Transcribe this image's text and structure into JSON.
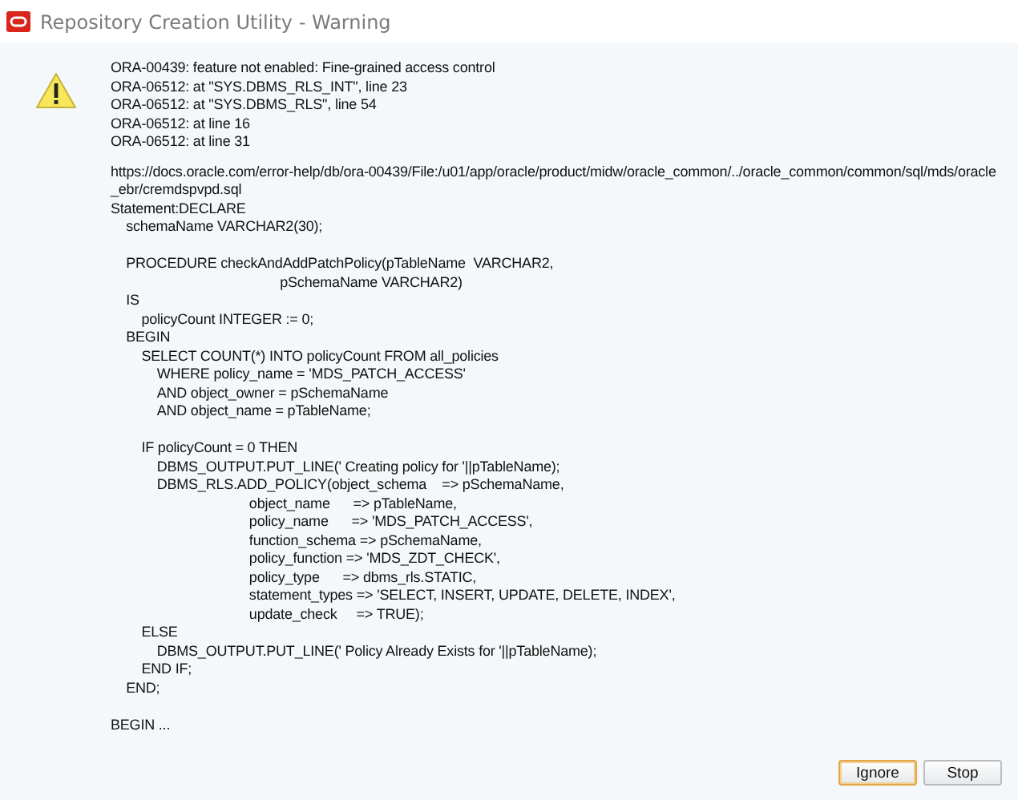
{
  "window": {
    "title": "Repository Creation Utility - Warning"
  },
  "message": {
    "errors": [
      "ORA-00439: feature not enabled: Fine-grained access control",
      "ORA-06512: at \"SYS.DBMS_RLS_INT\", line 23",
      "ORA-06512: at \"SYS.DBMS_RLS\", line 54",
      "ORA-06512: at line 16",
      "ORA-06512: at line 31"
    ],
    "details": [
      [
        "https://docs.oracle.com/error-help/db/ora-00439/File:/u01/app/oracle/product/midw/oracle_common/../oracle_common/common/sql/mds/oracle",
        "_ebr/cremdspvpd.sql",
        "Statement:DECLARE",
        "    schemaName VARCHAR2(30);"
      ],
      [
        "    PROCEDURE checkAndAddPatchPolicy(pTableName  VARCHAR2,",
        "                                            pSchemaName VARCHAR2)",
        "    IS",
        "        policyCount INTEGER := 0;",
        "    BEGIN",
        "        SELECT COUNT(*) INTO policyCount FROM all_policies",
        "            WHERE policy_name = 'MDS_PATCH_ACCESS'",
        "            AND object_owner = pSchemaName",
        "            AND object_name = pTableName;"
      ],
      [
        "        IF policyCount = 0 THEN",
        "            DBMS_OUTPUT.PUT_LINE(' Creating policy for '||pTableName);",
        "            DBMS_RLS.ADD_POLICY(object_schema    => pSchemaName,",
        "                                    object_name      => pTableName,",
        "                                    policy_name      => 'MDS_PATCH_ACCESS',",
        "                                    function_schema => pSchemaName,",
        "                                    policy_function => 'MDS_ZDT_CHECK',",
        "                                    policy_type      => dbms_rls.STATIC,",
        "                                    statement_types => 'SELECT, INSERT, UPDATE, DELETE, INDEX',",
        "                                    update_check     => TRUE);",
        "        ELSE",
        "            DBMS_OUTPUT.PUT_LINE(' Policy Already Exists for '||pTableName);",
        "        END IF;",
        "    END;"
      ],
      [
        "BEGIN ..."
      ]
    ]
  },
  "buttons": [
    {
      "label": "Ignore",
      "default": true
    },
    {
      "label": "Stop",
      "default": false
    }
  ]
}
